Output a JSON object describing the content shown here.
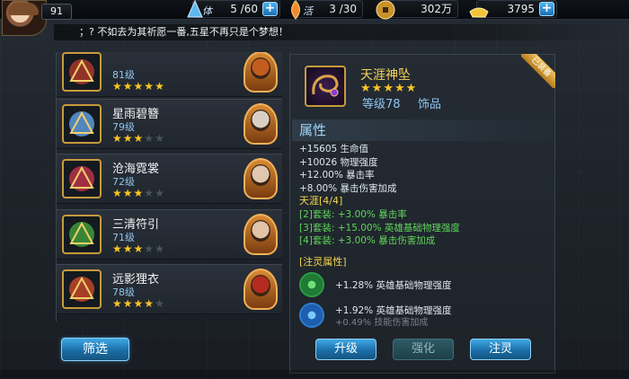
{
  "player": {
    "level": "91"
  },
  "resources": {
    "stamina_label": "体",
    "stamina": "5 /60",
    "vitality_label": "活",
    "vitality": "3 /30",
    "coins": "302万",
    "gold": "3795"
  },
  "ticker": "；? 不如去为其祈愿一番,五星不再只是个梦想！",
  "equipment_list": [
    {
      "name": "",
      "level": "81级",
      "stars": 5,
      "thumb_color": "#a8382a",
      "hero": "#c25d1f"
    },
    {
      "name": "星雨碧簪",
      "level": "79级",
      "stars": 3,
      "thumb_color": "#5a9bd8",
      "hero": "#d9cfc4"
    },
    {
      "name": "沧海霓裳",
      "level": "72级",
      "stars": 3,
      "thumb_color": "#b8324a",
      "hero": "#e1c6b0"
    },
    {
      "name": "三清符引",
      "level": "71级",
      "stars": 3,
      "thumb_color": "#3e9a3a",
      "hero": "#e2c3a8"
    },
    {
      "name": "远影狸衣",
      "level": "78级",
      "stars": 4,
      "thumb_color": "#c0472a",
      "hero": "#b52b1f"
    }
  ],
  "filter_label": "筛选",
  "detail": {
    "name": "天涯神坠",
    "stars": 5,
    "level": "等级78",
    "type": "饰品",
    "equipped_tag": "已装备",
    "attr_title": "属性",
    "attrs": [
      "+15605 生命值",
      "+10026 物理强度",
      "+12.00% 暴击率",
      "+8.00% 暴击伤害加成"
    ],
    "set_title": "天涯[4/4]",
    "set_bonuses": [
      "[2]套装: +3.00% 暴击率",
      "[3]套装: +15.00% 英雄基础物理强度",
      "[4]套装: +3.00% 暴击伤害加成"
    ],
    "spirit_title": "[注灵属性]",
    "spirit": [
      {
        "text": "+1.28%  英雄基础物理强度",
        "color": "#2fa24a"
      },
      {
        "text": "+1.92%  英雄基础物理强度",
        "color": "#2f7fcf"
      }
    ],
    "spirit_overflow": "+0.49%  技能伤害加成"
  },
  "actions": {
    "upgrade": "升级",
    "enhance": "强化",
    "infuse": "注灵"
  }
}
